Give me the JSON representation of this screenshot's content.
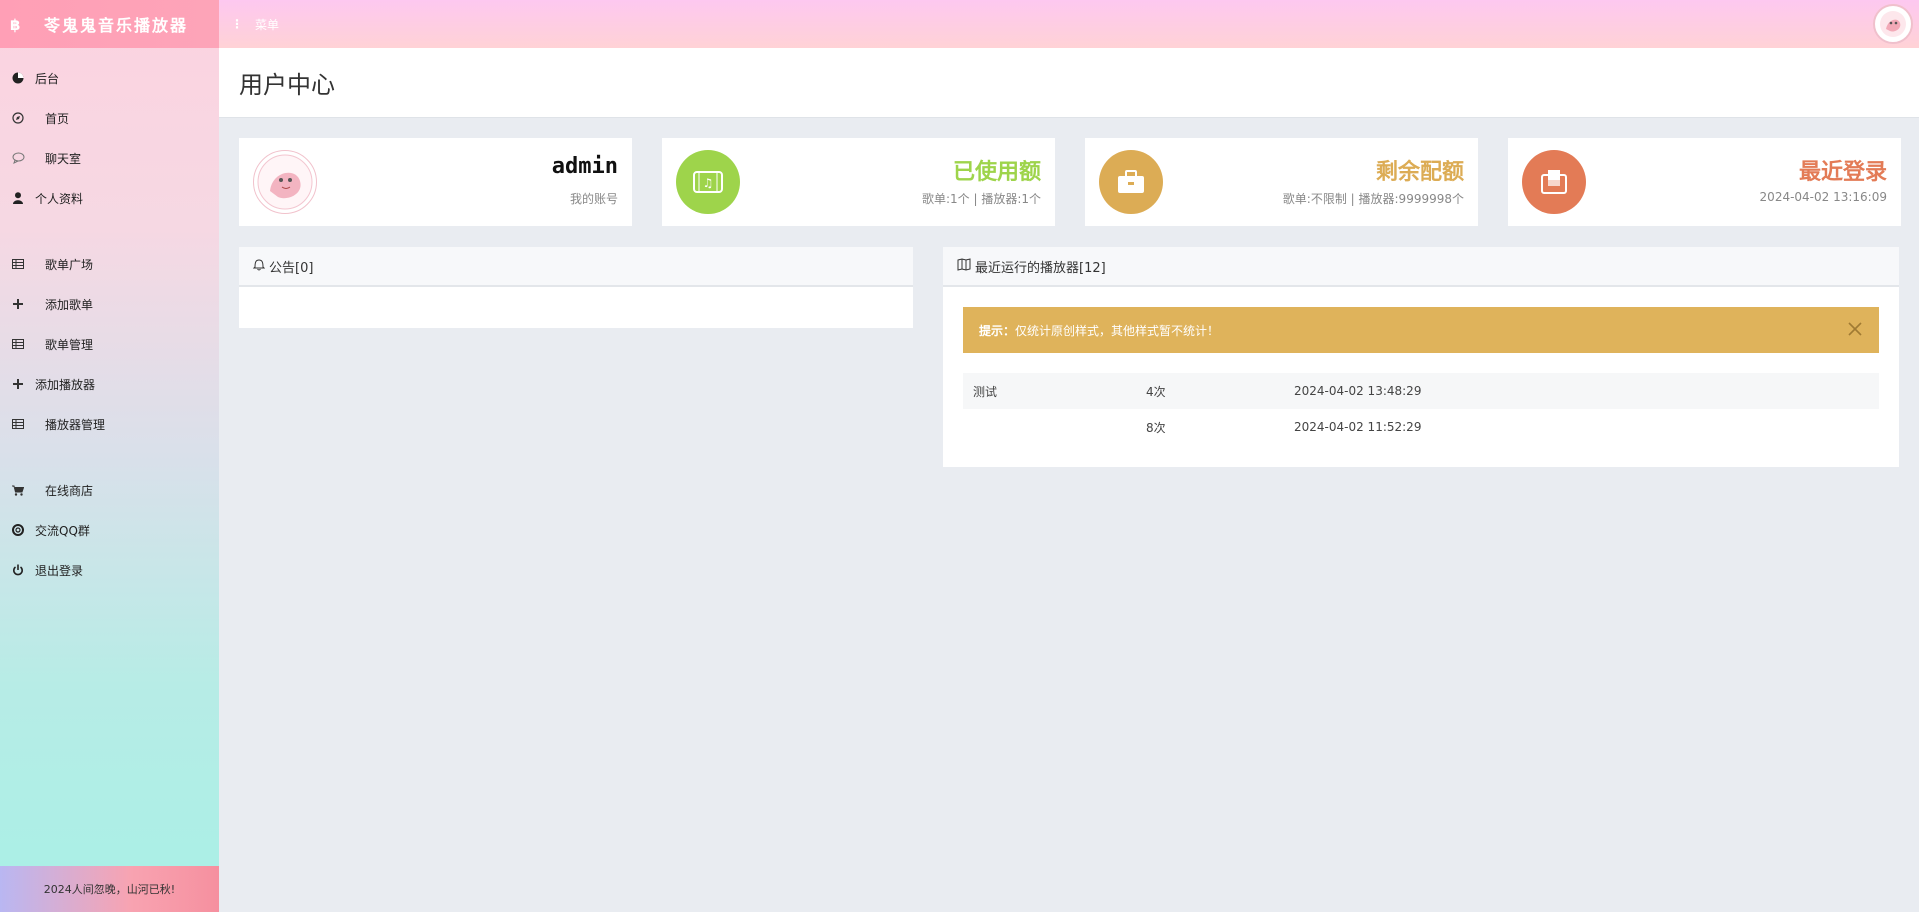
{
  "app": {
    "title": "苓鬼鬼音乐播放器",
    "menu_label": "菜单",
    "footer_text": "2024人间忽晚，山河已秋!"
  },
  "sidebar": {
    "groups": [
      [
        {
          "label": "后台",
          "icon": "pie-chart-icon"
        },
        {
          "label": "首页",
          "icon": "compass-icon"
        },
        {
          "label": "聊天室",
          "icon": "chat-icon"
        },
        {
          "label": "个人资料",
          "icon": "user-icon"
        }
      ],
      [
        {
          "label": "歌单广场",
          "icon": "table-icon"
        },
        {
          "label": "添加歌单",
          "icon": "plus-icon"
        },
        {
          "label": "歌单管理",
          "icon": "table-icon"
        },
        {
          "label": "添加播放器",
          "icon": "plus-icon"
        },
        {
          "label": "播放器管理",
          "icon": "table-icon"
        }
      ],
      [
        {
          "label": "在线商店",
          "icon": "cart-icon"
        },
        {
          "label": "交流QQ群",
          "icon": "lifebuoy-icon"
        },
        {
          "label": "退出登录",
          "icon": "power-icon"
        }
      ]
    ]
  },
  "page": {
    "title": "用户中心"
  },
  "stats": {
    "account": {
      "name": "admin",
      "sub": "我的账号"
    },
    "used": {
      "title": "已使用额",
      "sub": "歌单:1个 | 播放器:1个",
      "color": "#9ed44b"
    },
    "remaining": {
      "title": "剩余配额",
      "sub": "歌单:不限制 | 播放器:9999998个",
      "color": "#dcac55"
    },
    "last_login": {
      "title": "最近登录",
      "sub": "2024-04-02 13:16:09",
      "color": "#e37b56"
    }
  },
  "notice": {
    "title": "公告[0]"
  },
  "recent": {
    "title": "最近运行的播放器[12]",
    "alert_prefix": "提示：",
    "alert_text": "仅统计原创样式，其他样式暂不统计！",
    "rows": [
      {
        "name": "测试",
        "count": "4次",
        "time": "2024-04-02 13:48:29"
      },
      {
        "name": "",
        "count": "8次",
        "time": "2024-04-02 11:52:29"
      }
    ]
  }
}
